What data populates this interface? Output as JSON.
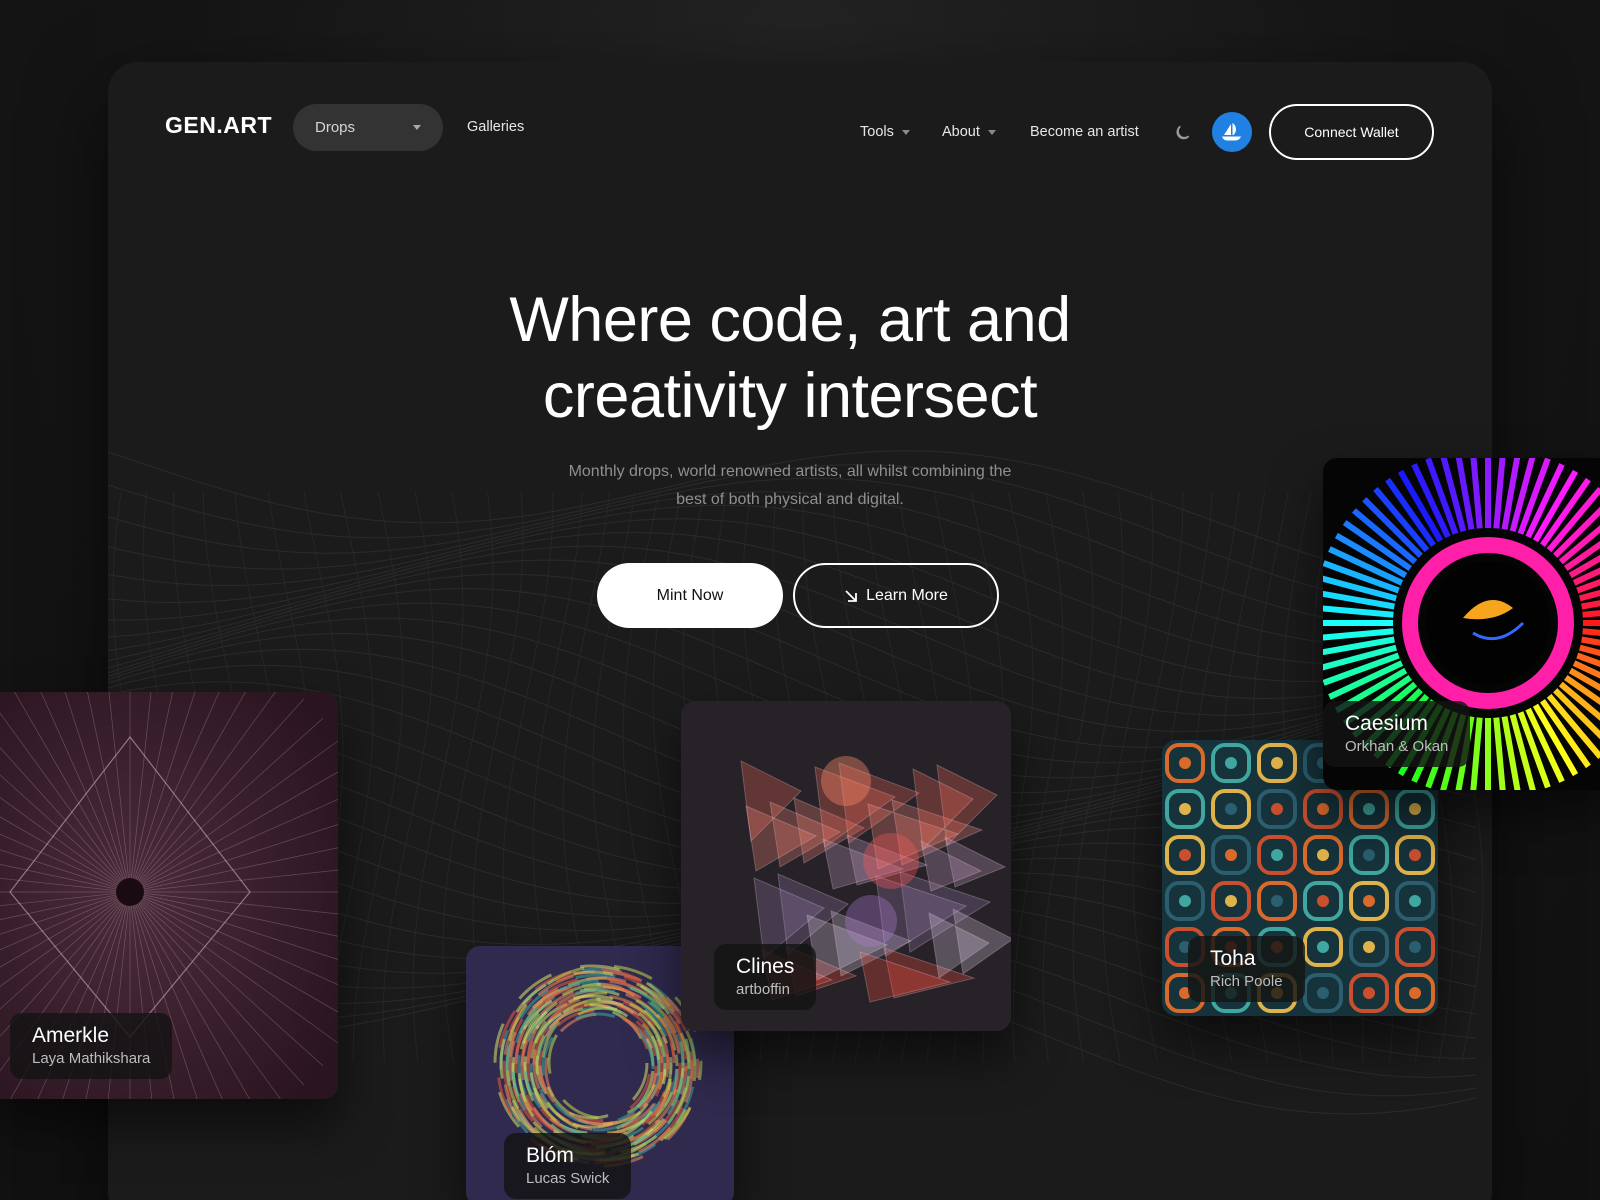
{
  "brand": {
    "logo": "GEN.ART"
  },
  "nav": {
    "drops_label": "Drops",
    "galleries_label": "Galleries",
    "tools_label": "Tools",
    "about_label": "About",
    "become_artist_label": "Become an artist",
    "connect_wallet_label": "Connect Wallet"
  },
  "hero": {
    "title_line1": "Where code, art and",
    "title_line2": "creativity intersect",
    "subtitle_line1": "Monthly drops, world renowned artists, all whilst combining the",
    "subtitle_line2": "best of both physical and digital.",
    "mint_label": "Mint Now",
    "learn_label": "Learn More"
  },
  "cards": [
    {
      "title": "Amerkle",
      "artist": "Laya Mathikshara"
    },
    {
      "title": "Blóm",
      "artist": "Lucas Swick"
    },
    {
      "title": "Clines",
      "artist": "artboffin"
    },
    {
      "title": "Toha",
      "artist": "Rich Poole"
    },
    {
      "title": "Caesium",
      "artist": "Orkhan & Okan"
    }
  ],
  "colors": {
    "background": "#161616",
    "panel": "#1b1b1b",
    "opensea_blue": "#2081e2",
    "accent_white": "#ffffff"
  },
  "icons": [
    "moon-icon",
    "opensea-icon",
    "chevron-down-icon",
    "arrow-down-right-icon"
  ]
}
